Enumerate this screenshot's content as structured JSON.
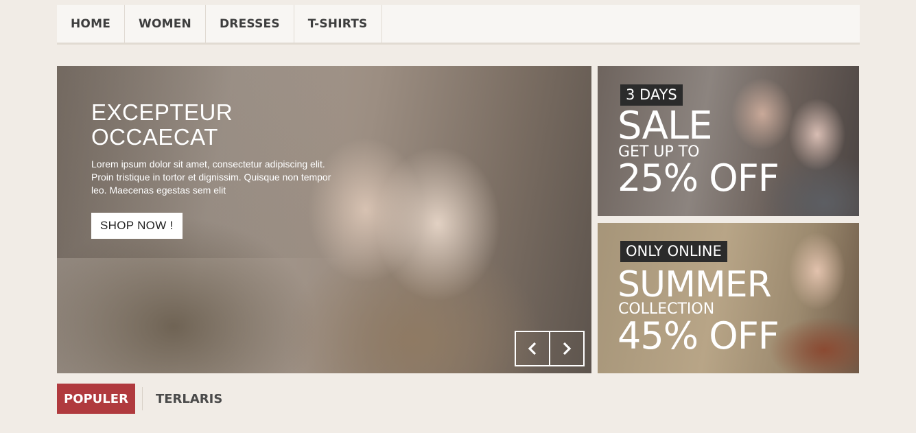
{
  "nav": {
    "items": [
      {
        "label": "HOME"
      },
      {
        "label": "WOMEN"
      },
      {
        "label": "DRESSES"
      },
      {
        "label": "T-SHIRTS"
      }
    ]
  },
  "hero": {
    "title_line1": "EXCEPTEUR",
    "title_line2": "OCCAECAT",
    "description": "Lorem ipsum dolor sit amet, consectetur adipiscing elit. Proin tristique in tortor et dignissim. Quisque non tempor leo. Maecenas egestas sem elit",
    "button_label": "SHOP NOW !",
    "prev_icon": "chevron-left-icon",
    "next_icon": "chevron-right-icon"
  },
  "promos": [
    {
      "tag": "3 DAYS",
      "headline": "SALE",
      "subline": "GET UP TO",
      "offer": "25% OFF"
    },
    {
      "tag": "ONLY ONLINE",
      "headline": "SUMMER",
      "subline": "COLLECTION",
      "offer": "45% OFF"
    }
  ],
  "tabs": [
    {
      "label": "POPULER",
      "active": true
    },
    {
      "label": "TERLARIS",
      "active": false
    }
  ],
  "colors": {
    "accent": "#b03a3e",
    "page_bg": "#f1ece6",
    "nav_bg": "#f8f6f3",
    "tag_bg": "#2b2b2b"
  }
}
